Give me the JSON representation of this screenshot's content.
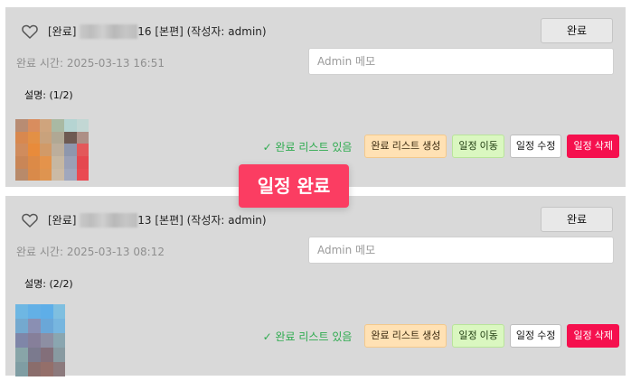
{
  "schedules": [
    {
      "title_prefix": "[완료]",
      "title_suffix": "16 [본편] (작성자: admin)",
      "complete_button": "완료",
      "completed_time": "완료 시간: 2025-03-13 16:51",
      "memo_placeholder": "Admin 메모",
      "description": "설명: (1/2)",
      "list_status": "✓ 완료 리스트 있음",
      "buttons": {
        "generate": "완료 리스트 생성",
        "move": "일정 이동",
        "edit": "일정 수정",
        "delete": "일정 삭제"
      }
    },
    {
      "title_prefix": "[완료]",
      "title_suffix": "13 [본편] (작성자: admin)",
      "complete_button": "완료",
      "completed_time": "완료 시간: 2025-03-13 08:12",
      "memo_placeholder": "Admin 메모",
      "description": "설명: (2/2)",
      "list_status": "✓ 완료 리스트 있음",
      "buttons": {
        "generate": "완료 리스트 생성",
        "move": "일정 이동",
        "edit": "일정 수정",
        "delete": "일정 삭제"
      }
    }
  ],
  "toast": {
    "text": "일정 완료"
  },
  "icons": {
    "favorite": "heart-outline-icon"
  },
  "colors": {
    "card_bg": "#d9d9d9",
    "status_green": "#2eab4f",
    "generate_bg": "#ffe1b4",
    "move_bg": "#daf7c0",
    "delete_bg": "#f5104e",
    "toast_bg": "#fb3d62"
  }
}
